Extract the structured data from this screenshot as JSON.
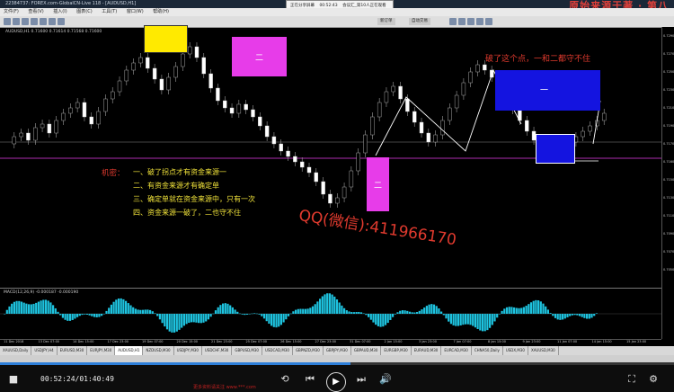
{
  "window": {
    "title": "22384737: FOREX.com-GlobalCN-Live 118 - [AUDUSD,H1]",
    "watermark_top": "原始来源于著 · 第八",
    "popup_items": [
      "正在分享屏幕",
      "00:52:43",
      "会议汇_第10人正在观看"
    ]
  },
  "menu": [
    "文件(F)",
    "查看(V)",
    "插入(I)",
    "图表(C)",
    "工具(T)",
    "窗口(W)",
    "帮助(H)"
  ],
  "toolbar": {
    "new_order": "新订单",
    "autotrade": "自动交易"
  },
  "chart": {
    "symbol_line": "AUDUSD,H1  0.71600 0.71614 0.71568 0.71600",
    "annotation": "破了这个点，一和二都守不住",
    "box_labels": {
      "two_top": "二",
      "two_bottom": "二",
      "one_blue": "一"
    },
    "secret_title": "机密：",
    "secret_lines": [
      "一、破了拐点才有资金来源一",
      "二、有资金来源才有确定单",
      "三、确定单就在资金来源中，只有一次",
      "四、资金来源一破了，二也守不住"
    ],
    "qq_overlay": "QQ(微信):411966170",
    "price_labels": [
      "0.72900",
      "0.72700",
      "0.72500",
      "0.72300",
      "0.72100",
      "0.71900",
      "0.71700",
      "0.71600",
      "0.71500",
      "0.71300",
      "0.71100",
      "0.70900",
      "0.70700",
      "0.70500"
    ],
    "current_price": "0.71600"
  },
  "indicator": {
    "label": "MACD(12,26,9) -0.000187 -0.000190"
  },
  "time_axis": [
    "11 Dec 2018",
    "13 Dec 07:00",
    "14 Dec 15:00",
    "17 Dec 23:00",
    "19 Dec 07:00",
    "20 Dec 15:00",
    "21 Dec 23:00",
    "25 Dec 07:00",
    "26 Dec 15:00",
    "27 Dec 23:00",
    "31 Dec 07:00",
    "2 Jan 15:00",
    "3 Jan 23:00",
    "7 Jan 07:00",
    "8 Jan 15:00",
    "9 Jan 23:00",
    "11 Jan 07:00",
    "14 Jan 15:00",
    "15 Jan 23:00"
  ],
  "symbol_tabs": [
    "XAUUSD,Daily",
    "USDJPY,H4",
    "EURUSD,M30",
    "EURJPY,M30",
    "AUDUSD,H1",
    "NZDUSD,M30",
    "USDJPY,M30",
    "USDCHF,M30",
    "GBPUSD,M30",
    "USDCAD,M30",
    "GBPNZD,M30",
    "GBPJPY,M30",
    "GBPAUD,M30",
    "EURGBP,M30",
    "EURAUD,M30",
    "EURCAD,M30",
    "CHNA50,Daily",
    "USDX,M30",
    "XAUUSD,M30"
  ],
  "active_tab_index": 4,
  "player": {
    "time_current": "00:52:24",
    "time_total": "01:40:49",
    "time_display": "00:52:24/01:40:49",
    "progress_fraction": 0.52,
    "bottom_text": "更多资料请关注 www.***.com"
  }
}
